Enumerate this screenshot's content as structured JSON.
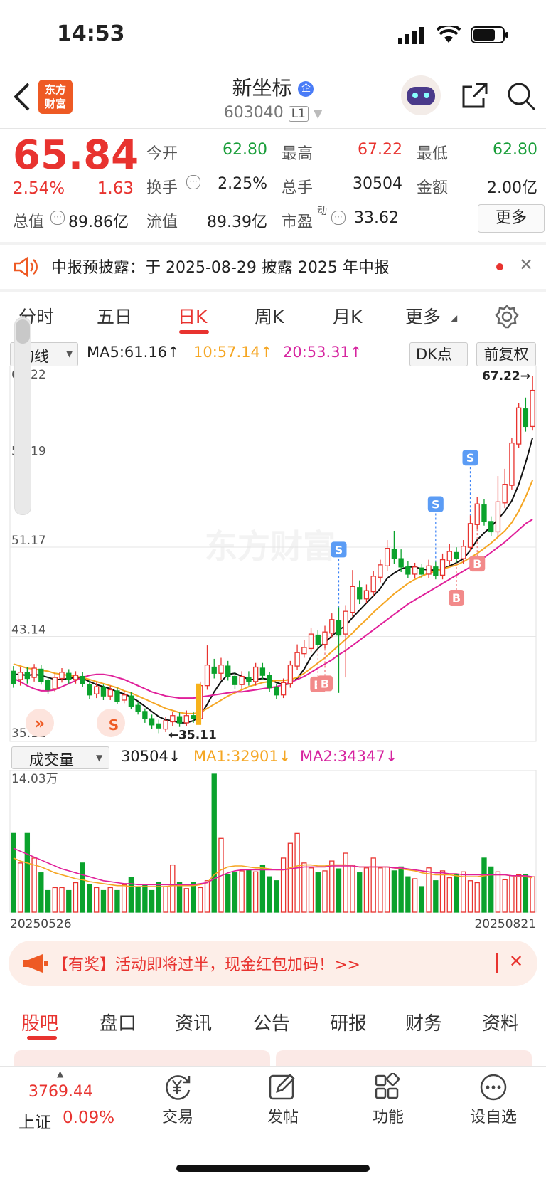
{
  "status_bar": {
    "time": "14:53"
  },
  "header": {
    "logo_text_1": "东方",
    "logo_text_2": "财富",
    "name": "新坐标",
    "badge": "企",
    "code": "603040",
    "level": "L1"
  },
  "quote": {
    "price": "65.84",
    "change_pct": "2.54%",
    "change": "1.63",
    "total_cap_label": "总值",
    "total_cap": "89.86亿",
    "open_label": "今开",
    "open": "62.80",
    "high_label": "最高",
    "high": "67.22",
    "low_label": "最低",
    "low": "62.80",
    "turnover_label": "换手",
    "turnover": "2.25%",
    "volume_label": "总手",
    "volume": "30504",
    "amount_label": "金额",
    "amount": "2.00亿",
    "float_cap_label": "流值",
    "float_cap": "89.39亿",
    "pe_label": "市盈",
    "pe_sup": "动",
    "pe": "33.62",
    "more_label": "更多"
  },
  "notice": {
    "text": "中报预披露：于 2025-08-29 披露 2025 年中报"
  },
  "tabs": [
    "分时",
    "五日",
    "日K",
    "周K",
    "月K",
    "更多"
  ],
  "active_tab": "日K",
  "kline_bar": {
    "type": "均线",
    "ma5": "MA5:61.16↑",
    "ma10": "10:57.14↑",
    "ma20": "20:53.31↑",
    "dk": "DK点",
    "adjust": "前复权"
  },
  "volume_bar": {
    "type": "成交量",
    "vol": "30504↓",
    "ma1": "MA1:32901↓",
    "ma2": "MA2:34347↓"
  },
  "colors": {
    "up": "#e8332f",
    "down": "#0aa22c",
    "ma5": "#111111",
    "ma10": "#f5a623",
    "ma20": "#e0209a"
  },
  "chart_data": {
    "type": "candlestick",
    "y_ticks": [
      "67.22",
      "59.19",
      "51.17",
      "43.14",
      "35.11"
    ],
    "ylim": [
      35.11,
      67.22
    ],
    "annotations": {
      "high": "67.22→",
      "low": "←35.11"
    },
    "volume_max_label": "14.03万",
    "date_start": "20250526",
    "date_end": "20250821",
    "candles": [
      [
        38.6,
        37.4,
        39.1,
        37.0
      ],
      [
        37.8,
        38.5,
        39.0,
        37.2
      ],
      [
        38.5,
        37.9,
        39.0,
        37.4
      ],
      [
        38.0,
        38.9,
        39.3,
        37.6
      ],
      [
        38.8,
        37.6,
        39.2,
        37.3
      ],
      [
        37.7,
        36.8,
        38.1,
        36.4
      ],
      [
        36.9,
        38.0,
        38.4,
        36.6
      ],
      [
        37.9,
        38.5,
        38.9,
        37.5
      ],
      [
        38.4,
        37.8,
        38.8,
        37.4
      ],
      [
        37.8,
        38.2,
        38.6,
        37.4
      ],
      [
        38.1,
        37.4,
        38.5,
        37.1
      ],
      [
        37.3,
        36.3,
        37.7,
        35.9
      ],
      [
        36.4,
        37.1,
        37.5,
        36.0
      ],
      [
        37.0,
        36.2,
        37.3,
        35.8
      ],
      [
        36.2,
        36.8,
        37.2,
        35.8
      ],
      [
        36.7,
        35.7,
        37.0,
        35.4
      ],
      [
        35.8,
        36.3,
        36.7,
        35.5
      ],
      [
        36.2,
        35.2,
        36.6,
        34.9
      ],
      [
        35.3,
        34.7,
        35.6,
        34.4
      ],
      [
        34.7,
        34.0,
        35.0,
        33.6
      ],
      [
        34.0,
        33.4,
        34.4,
        33.0
      ],
      [
        33.5,
        33.1,
        33.9,
        32.6
      ],
      [
        33.0,
        33.8,
        34.2,
        32.7
      ],
      [
        33.7,
        34.3,
        34.7,
        33.3
      ],
      [
        34.2,
        33.6,
        34.6,
        33.2
      ],
      [
        33.6,
        34.3,
        34.8,
        33.3
      ],
      [
        34.3,
        34.0,
        34.7,
        33.6
      ],
      [
        34.0,
        37.2,
        37.6,
        33.8
      ],
      [
        37.2,
        39.2,
        41.1,
        36.8
      ],
      [
        39.0,
        38.4,
        39.8,
        37.9
      ],
      [
        38.4,
        39.2,
        39.9,
        37.8
      ],
      [
        39.1,
        38.1,
        39.6,
        37.7
      ],
      [
        38.1,
        37.3,
        38.5,
        36.9
      ],
      [
        37.3,
        38.1,
        38.6,
        36.9
      ],
      [
        38.0,
        37.6,
        38.6,
        37.2
      ],
      [
        37.6,
        39.0,
        39.4,
        37.2
      ],
      [
        38.9,
        38.2,
        39.4,
        37.8
      ],
      [
        38.2,
        37.0,
        38.5,
        36.6
      ],
      [
        37.0,
        36.3,
        37.4,
        35.9
      ],
      [
        36.3,
        37.5,
        37.9,
        36.0
      ],
      [
        37.4,
        39.2,
        39.6,
        37.0
      ],
      [
        39.1,
        40.4,
        41.2,
        38.7
      ],
      [
        40.3,
        40.9,
        41.6,
        39.9
      ],
      [
        40.8,
        42.2,
        42.8,
        40.4
      ],
      [
        42.1,
        41.2,
        42.6,
        40.7
      ],
      [
        41.2,
        42.4,
        43.0,
        40.8
      ],
      [
        42.3,
        43.6,
        44.2,
        41.9
      ],
      [
        43.5,
        42.1,
        44.8,
        36.5
      ],
      [
        42.2,
        44.4,
        45.0,
        38.0
      ],
      [
        44.3,
        46.8,
        48.4,
        43.9
      ],
      [
        46.7,
        45.6,
        47.4,
        45.1
      ],
      [
        45.6,
        46.4,
        47.0,
        45.2
      ],
      [
        46.3,
        47.8,
        48.3,
        45.9
      ],
      [
        47.7,
        48.9,
        49.4,
        47.2
      ],
      [
        48.8,
        50.5,
        51.3,
        48.3
      ],
      [
        50.4,
        49.5,
        52.2,
        49.0
      ],
      [
        49.5,
        48.7,
        50.4,
        48.2
      ],
      [
        48.7,
        48.0,
        49.3,
        47.6
      ],
      [
        48.0,
        48.7,
        49.1,
        47.6
      ],
      [
        48.6,
        48.0,
        49.0,
        47.6
      ],
      [
        48.0,
        48.8,
        49.4,
        47.6
      ],
      [
        48.7,
        47.9,
        49.2,
        47.5
      ],
      [
        47.9,
        49.4,
        50.0,
        47.5
      ],
      [
        49.3,
        50.2,
        50.9,
        48.9
      ],
      [
        50.1,
        49.5,
        50.6,
        49.1
      ],
      [
        49.5,
        50.7,
        51.3,
        49.0
      ],
      [
        50.6,
        52.9,
        53.7,
        50.2
      ],
      [
        52.8,
        54.8,
        55.5,
        52.4
      ],
      [
        54.7,
        53.1,
        55.3,
        52.7
      ],
      [
        53.1,
        52.1,
        53.6,
        51.7
      ],
      [
        52.1,
        55.0,
        57.5,
        51.6
      ],
      [
        54.9,
        56.7,
        58.2,
        54.4
      ],
      [
        56.6,
        60.7,
        61.2,
        56.2
      ],
      [
        60.6,
        64.1,
        64.6,
        60.2
      ],
      [
        64.0,
        62.3,
        65.1,
        61.8
      ],
      [
        62.3,
        65.8,
        67.22,
        61.9
      ]
    ],
    "ma_lines": {
      "MA5": [
        38.3,
        38.3,
        38.2,
        38.3,
        38.2,
        38.0,
        37.8,
        37.8,
        37.9,
        38.0,
        37.9,
        37.6,
        37.3,
        37.1,
        36.9,
        36.6,
        36.4,
        36.1,
        35.7,
        35.2,
        34.7,
        34.2,
        33.9,
        33.8,
        33.6,
        33.6,
        33.8,
        34.3,
        35.4,
        36.6,
        37.6,
        38.3,
        38.4,
        38.1,
        37.8,
        37.8,
        37.9,
        37.8,
        37.5,
        37.3,
        37.4,
        37.9,
        38.8,
        40.0,
        40.8,
        41.4,
        42.0,
        42.6,
        43.0,
        43.8,
        44.5,
        45.2,
        45.9,
        46.6,
        47.6,
        48.1,
        48.5,
        48.7,
        48.7,
        48.5,
        48.4,
        48.4,
        48.5,
        48.8,
        49.1,
        49.5,
        50.3,
        51.3,
        52.0,
        52.6,
        53.3,
        54.1,
        55.1,
        56.7,
        58.8,
        61.2
      ],
      "MA10": [
        39.3,
        39.1,
        38.9,
        38.8,
        38.7,
        38.6,
        38.4,
        38.3,
        38.2,
        38.1,
        38.0,
        37.8,
        37.6,
        37.4,
        37.2,
        37.0,
        36.7,
        36.5,
        36.2,
        35.9,
        35.6,
        35.3,
        35.0,
        34.8,
        34.6,
        34.5,
        34.5,
        34.6,
        35.0,
        35.4,
        35.8,
        36.2,
        36.5,
        36.8,
        37.1,
        37.3,
        37.5,
        37.6,
        37.7,
        37.7,
        37.8,
        38.0,
        38.4,
        38.9,
        39.4,
        39.9,
        40.5,
        41.1,
        41.7,
        42.3,
        43.0,
        43.6,
        44.3,
        44.9,
        45.5,
        46.1,
        46.6,
        47.1,
        47.5,
        47.8,
        48.1,
        48.3,
        48.5,
        48.7,
        48.9,
        49.2,
        49.6,
        50.0,
        50.5,
        51.0,
        51.6,
        52.2,
        53.0,
        54.1,
        55.5,
        57.1
      ],
      "MA20": [
        37.9,
        37.6,
        37.2,
        36.9,
        36.7,
        36.7,
        36.8,
        37.1,
        37.4,
        37.7,
        38.0,
        38.2,
        38.3,
        38.3,
        38.2,
        38.0,
        37.8,
        37.5,
        37.2,
        36.9,
        36.6,
        36.4,
        36.2,
        36.1,
        36.0,
        36.0,
        36.0,
        36.1,
        36.2,
        36.3,
        36.4,
        36.5,
        36.6,
        36.6,
        36.7,
        36.8,
        36.9,
        37.0,
        37.1,
        37.3,
        37.5,
        37.8,
        38.1,
        38.5,
        38.9,
        39.3,
        39.7,
        40.2,
        40.6,
        41.1,
        41.6,
        42.1,
        42.6,
        43.1,
        43.6,
        44.1,
        44.6,
        45.1,
        45.5,
        45.9,
        46.3,
        46.7,
        47.1,
        47.5,
        47.9,
        48.3,
        48.7,
        49.1,
        49.6,
        50.1,
        50.6,
        51.1,
        51.7,
        52.3,
        52.9,
        53.3
      ]
    },
    "volume": [
      8,
      5,
      8,
      5.5,
      4,
      2.2,
      2.5,
      2.5,
      2.2,
      3,
      5,
      2.8,
      2.5,
      2.2,
      2.5,
      2.2,
      2.8,
      3.5,
      2.5,
      2.8,
      2.2,
      3,
      2.6,
      4.8,
      3,
      2.4,
      3,
      2.5,
      3.2,
      14.03,
      7.5,
      3.8,
      4,
      4.2,
      4.3,
      4.1,
      4.8,
      3.6,
      3.2,
      5.5,
      7,
      8,
      5,
      4.5,
      4,
      4.2,
      5.2,
      4.4,
      6,
      4.8,
      4,
      4.5,
      5.5,
      4.5,
      4.6,
      4.2,
      4.6,
      3.6,
      3.4,
      2.6,
      4.5,
      3.2,
      4.2,
      3.5,
      3.8,
      4.1,
      3.2,
      3.0,
      5.5,
      4.6,
      4.1,
      3.3,
      3.7,
      3.8,
      3.8,
      3.6
    ],
    "vol_ma": {
      "MA1": [
        5.5,
        5.2,
        5.0,
        4.8,
        4.6,
        4.3,
        4.0,
        3.8,
        3.6,
        3.4,
        3.3,
        3.1,
        3.0,
        2.9,
        2.8,
        2.7,
        2.7,
        2.6,
        2.6,
        2.6,
        2.6,
        2.6,
        2.6,
        2.7,
        2.7,
        2.7,
        2.7,
        2.8,
        3.0,
        3.8,
        4.3,
        4.6,
        4.7,
        4.7,
        4.6,
        4.5,
        4.5,
        4.4,
        4.3,
        4.3,
        4.5,
        4.7,
        4.8,
        4.8,
        4.7,
        4.7,
        4.8,
        4.8,
        4.8,
        4.7,
        4.6,
        4.6,
        4.6,
        4.6,
        4.6,
        4.5,
        4.4,
        4.3,
        4.2,
        4.0,
        3.9,
        3.8,
        3.8,
        3.8,
        3.7,
        3.6,
        3.6,
        3.6,
        3.7,
        3.8,
        3.8,
        3.8,
        3.7,
        3.6,
        3.6,
        3.5
      ],
      "MA2": [
        6.5,
        6.2,
        5.9,
        5.6,
        5.3,
        5.0,
        4.7,
        4.4,
        4.2,
        4.0,
        3.8,
        3.6,
        3.4,
        3.2,
        3.1,
        3.0,
        2.9,
        2.9,
        2.8,
        2.8,
        2.8,
        2.8,
        2.8,
        2.8,
        2.8,
        2.8,
        2.8,
        2.9,
        3.0,
        3.4,
        3.7,
        4.0,
        4.2,
        4.3,
        4.3,
        4.3,
        4.3,
        4.3,
        4.3,
        4.3,
        4.4,
        4.5,
        4.6,
        4.6,
        4.6,
        4.6,
        4.7,
        4.7,
        4.7,
        4.7,
        4.6,
        4.6,
        4.6,
        4.6,
        4.6,
        4.5,
        4.5,
        4.4,
        4.3,
        4.2,
        4.1,
        4.0,
        4.0,
        3.9,
        3.9,
        3.8,
        3.8,
        3.8,
        3.8,
        3.8,
        3.8,
        3.8,
        3.7,
        3.7,
        3.7,
        3.6
      ]
    },
    "signals": [
      {
        "label": "S",
        "idx": 47,
        "kind": "sell"
      },
      {
        "label": "B",
        "idx": 44,
        "kind": "buy"
      },
      {
        "label": "B",
        "idx": 45,
        "kind": "buy"
      },
      {
        "label": "S",
        "idx": 61,
        "kind": "sell"
      },
      {
        "label": "B",
        "idx": 64,
        "kind": "buy"
      },
      {
        "label": "S",
        "idx": 66,
        "kind": "sell"
      },
      {
        "label": "B",
        "idx": 67,
        "kind": "buy"
      }
    ]
  },
  "promo": {
    "text": "【有奖】活动即将过半，现金红包加码！>>"
  },
  "bottom_tabs": [
    "股吧",
    "盘口",
    "资讯",
    "公告",
    "研报",
    "财务",
    "资料"
  ],
  "bottom_nav": {
    "index_value": "3769.44",
    "index_name": "上证",
    "index_change": "0.09%",
    "trade": "交易",
    "post": "发帖",
    "function": "功能",
    "watch": "设自选"
  }
}
